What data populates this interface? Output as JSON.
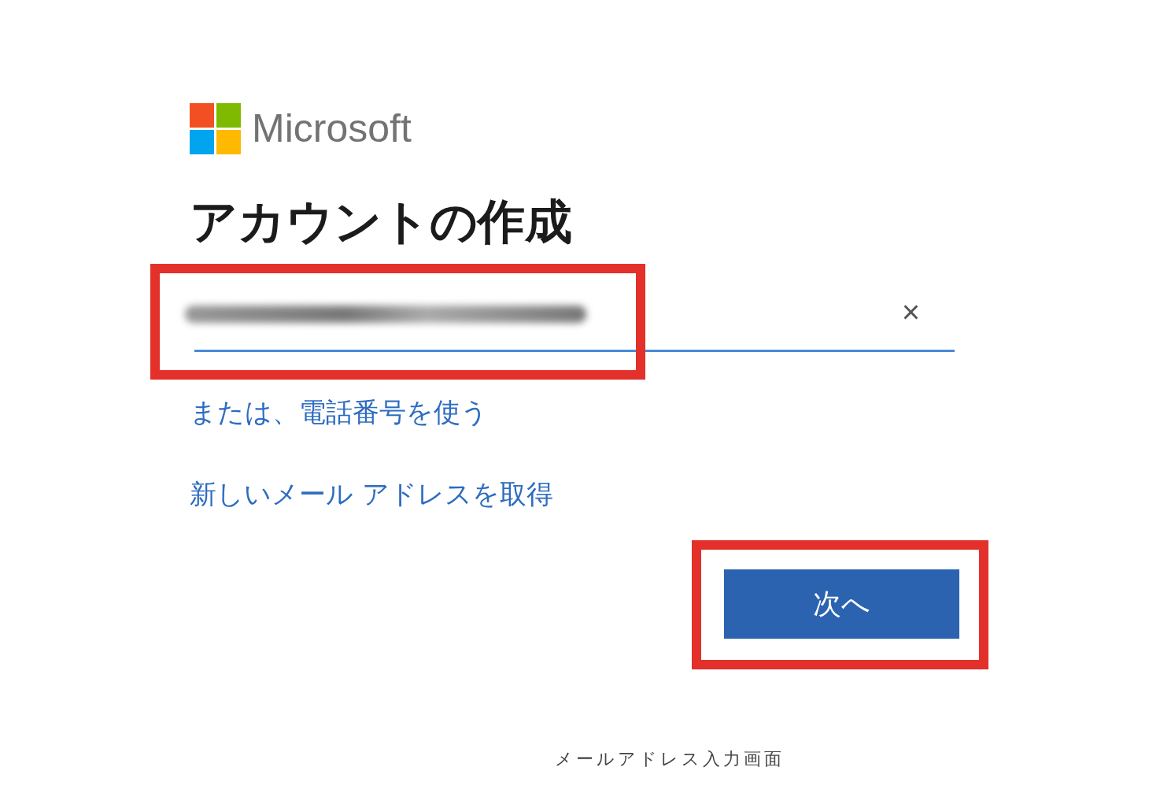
{
  "logo": {
    "text": "Microsoft"
  },
  "heading": "アカウントの作成",
  "email_field": {
    "value_hidden": true,
    "clear": "×",
    "highlighted": true
  },
  "links": [
    "または、電話番号を使う",
    "新しいメール アドレスを取得"
  ],
  "next_button": {
    "label": "次へ",
    "highlighted": true
  },
  "caption": "メールアドレス入力画面"
}
